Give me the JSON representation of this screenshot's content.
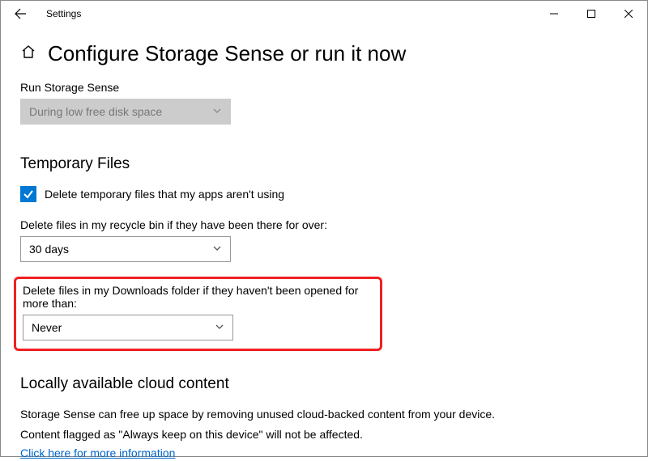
{
  "app_title": "Settings",
  "page_title": "Configure Storage Sense or run it now",
  "run_sense": {
    "label": "Run Storage Sense",
    "value": "During low free disk space"
  },
  "temp_files": {
    "heading": "Temporary Files",
    "checkbox_label": "Delete temporary files that my apps aren't using",
    "recycle_label": "Delete files in my recycle bin if they have been there for over:",
    "recycle_value": "30 days",
    "downloads_label": "Delete files in my Downloads folder if they haven't been opened for more than:",
    "downloads_value": "Never"
  },
  "cloud": {
    "heading": "Locally available cloud content",
    "line1": "Storage Sense can free up space by removing unused cloud-backed content from your device.",
    "line2": "Content flagged as \"Always keep on this device\" will not be affected.",
    "link": "Click here for more information"
  }
}
